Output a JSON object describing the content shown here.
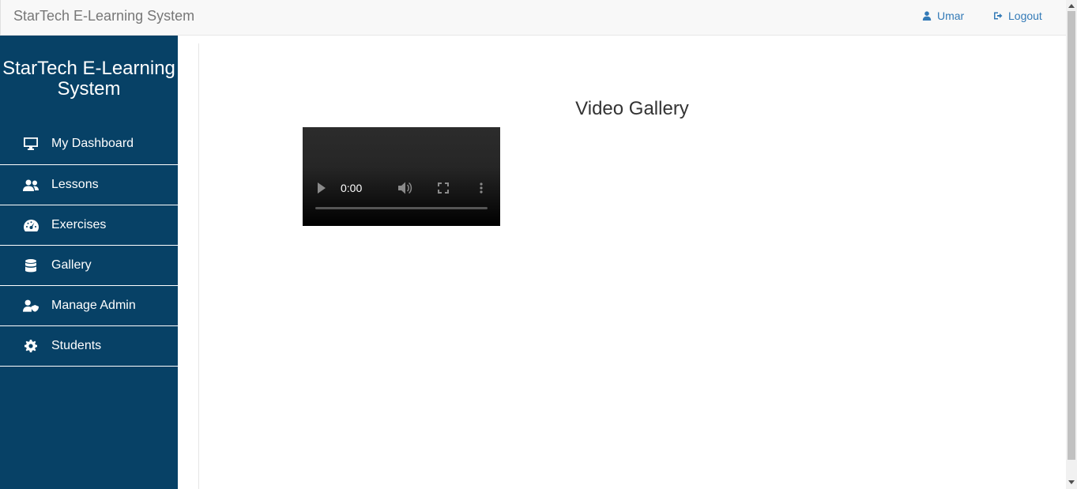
{
  "navbar": {
    "brand": "StarTech E-Learning System",
    "user_label": "Umar",
    "logout_label": "Logout"
  },
  "sidebar": {
    "title": "StarTech E-Learning System",
    "items": [
      {
        "label": "My Dashboard",
        "icon": "monitor-icon"
      },
      {
        "label": "Lessons",
        "icon": "users-icon"
      },
      {
        "label": "Exercises",
        "icon": "gauge-icon"
      },
      {
        "label": "Gallery",
        "icon": "database-icon"
      },
      {
        "label": "Manage Admin",
        "icon": "user-shield-icon"
      },
      {
        "label": "Students",
        "icon": "gear-icon"
      }
    ]
  },
  "main": {
    "title": "Video Gallery",
    "video": {
      "current_time": "0:00"
    }
  },
  "colors": {
    "sidebar_bg": "#074166",
    "link": "#337ab7",
    "navbar_bg": "#f8f8f8"
  }
}
